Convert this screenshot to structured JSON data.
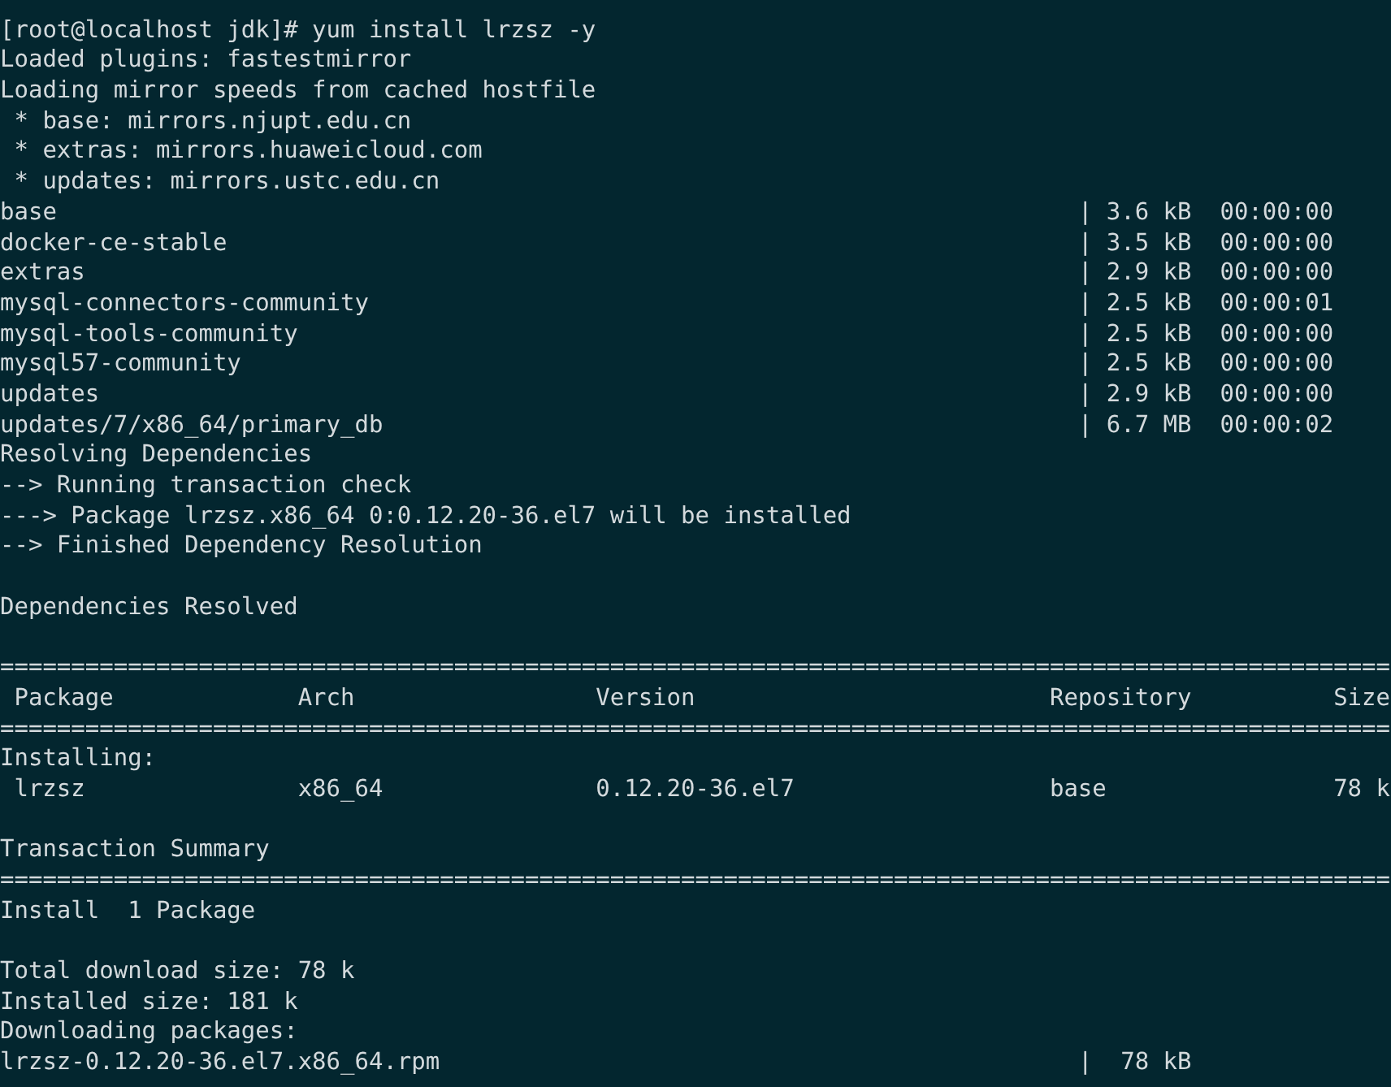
{
  "terminal": {
    "lines": [
      {
        "kind": "text",
        "text": "[root@localhost jdk]# yum install lrzsz -y"
      },
      {
        "kind": "text",
        "text": "Loaded plugins: fastestmirror"
      },
      {
        "kind": "text",
        "text": "Loading mirror speeds from cached hostfile"
      },
      {
        "kind": "text",
        "text": " * base: mirrors.njupt.edu.cn"
      },
      {
        "kind": "text",
        "text": " * extras: mirrors.huaweicloud.com"
      },
      {
        "kind": "text",
        "text": " * updates: mirrors.ustc.edu.cn"
      },
      {
        "kind": "repo",
        "name": "base",
        "bar": "|",
        "size": "3.6 kB",
        "time": "00:00:00"
      },
      {
        "kind": "repo",
        "name": "docker-ce-stable",
        "bar": "|",
        "size": "3.5 kB",
        "time": "00:00:00"
      },
      {
        "kind": "repo",
        "name": "extras",
        "bar": "|",
        "size": "2.9 kB",
        "time": "00:00:00"
      },
      {
        "kind": "repo",
        "name": "mysql-connectors-community",
        "bar": "|",
        "size": "2.5 kB",
        "time": "00:00:01"
      },
      {
        "kind": "repo",
        "name": "mysql-tools-community",
        "bar": "|",
        "size": "2.5 kB",
        "time": "00:00:00"
      },
      {
        "kind": "repo",
        "name": "mysql57-community",
        "bar": "|",
        "size": "2.5 kB",
        "time": "00:00:00"
      },
      {
        "kind": "repo",
        "name": "updates",
        "bar": "|",
        "size": "2.9 kB",
        "time": "00:00:00"
      },
      {
        "kind": "repo",
        "name": "updates/7/x86_64/primary_db",
        "bar": "|",
        "size": "6.7 MB",
        "time": "00:00:02"
      },
      {
        "kind": "text",
        "text": "Resolving Dependencies"
      },
      {
        "kind": "text",
        "text": "--> Running transaction check"
      },
      {
        "kind": "text",
        "text": "---> Package lrzsz.x86_64 0:0.12.20-36.el7 will be installed"
      },
      {
        "kind": "text",
        "text": "--> Finished Dependency Resolution"
      },
      {
        "kind": "blank"
      },
      {
        "kind": "text",
        "text": "Dependencies Resolved"
      },
      {
        "kind": "blank"
      },
      {
        "kind": "rule",
        "text": "=================================================================================================="
      },
      {
        "kind": "header",
        "cells": [
          "Package",
          "Arch",
          "Version",
          "Repository",
          "Size"
        ]
      },
      {
        "kind": "rule",
        "text": "=================================================================================================="
      },
      {
        "kind": "text",
        "text": "Installing:"
      },
      {
        "kind": "row",
        "cells": [
          "lrzsz",
          "x86_64",
          "0.12.20-36.el7",
          "base",
          "78 k"
        ]
      },
      {
        "kind": "blank"
      },
      {
        "kind": "text",
        "text": "Transaction Summary"
      },
      {
        "kind": "rule",
        "text": "=================================================================================================="
      },
      {
        "kind": "text",
        "text": "Install  1 Package"
      },
      {
        "kind": "blank"
      },
      {
        "kind": "text",
        "text": "Total download size: 78 k"
      },
      {
        "kind": "text",
        "text": "Installed size: 181 k"
      },
      {
        "kind": "text",
        "text": "Downloading packages:"
      },
      {
        "kind": "repo",
        "name": "lrzsz-0.12.20-36.el7.x86_64.rpm",
        "bar": "|",
        "size": "78 kB"
      }
    ]
  }
}
